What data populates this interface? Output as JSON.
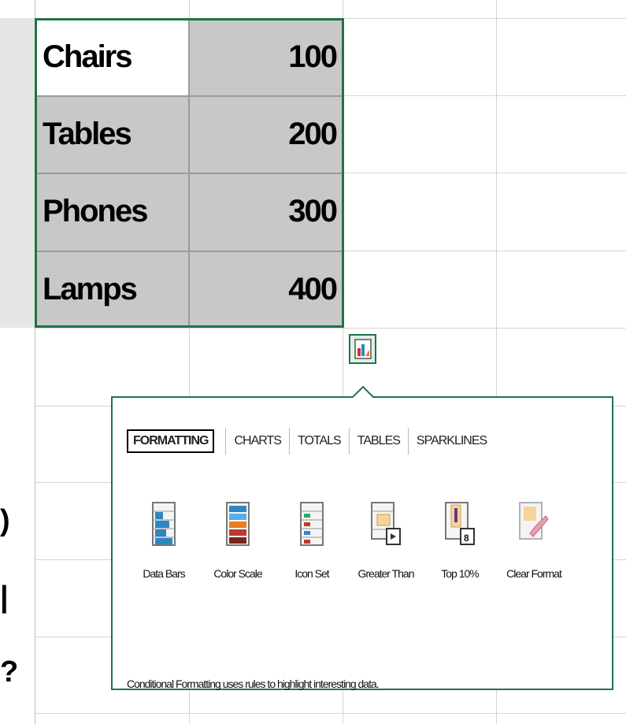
{
  "sheet": {
    "rows": [
      {
        "label": "Chairs",
        "value": "100"
      },
      {
        "label": "Tables",
        "value": "200"
      },
      {
        "label": "Phones",
        "value": "300"
      },
      {
        "label": "Lamps",
        "value": "400"
      }
    ],
    "left_edge_fragments": [
      ")",
      "|",
      "?"
    ]
  },
  "quick_analysis": {
    "tabs": [
      {
        "label": "FORMATTING",
        "active": true
      },
      {
        "label": "CHARTS",
        "active": false
      },
      {
        "label": "TOTALS",
        "active": false
      },
      {
        "label": "TABLES",
        "active": false
      },
      {
        "label": "SPARKLINES",
        "active": false
      }
    ],
    "tools": [
      {
        "label": "Data Bars",
        "icon": "data-bars-icon"
      },
      {
        "label": "Color Scale",
        "icon": "color-scale-icon"
      },
      {
        "label": "Icon Set",
        "icon": "icon-set-icon"
      },
      {
        "label": "Greater Than",
        "icon": "greater-than-icon"
      },
      {
        "label": "Top 10%",
        "icon": "top-10-icon"
      },
      {
        "label": "Clear Format",
        "icon": "clear-format-icon"
      }
    ],
    "description": "Conditional Formatting uses rules to highlight interesting data."
  },
  "colors": {
    "accent": "#217346",
    "selection_fill": "#c8c8c8"
  }
}
